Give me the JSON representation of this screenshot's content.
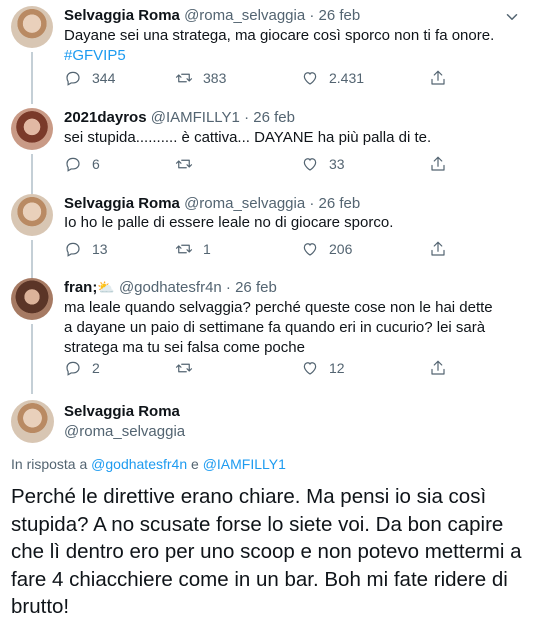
{
  "tweets": [
    {
      "name": "Selvaggia Roma",
      "handle": "@roma_selvaggia",
      "dot": "·",
      "date": "26 feb",
      "text": "Dayane sei una stratega, ma giocare così sporco non ti fa onore.",
      "hashtag": "#GFVIP5",
      "replies": "344",
      "retweets": "383",
      "likes": "2.431"
    },
    {
      "name": "2021dayros",
      "handle": "@IAMFILLY1",
      "dot": "·",
      "date": "26 feb",
      "text": "sei stupida.......... è cattiva... DAYANE ha più palla di te.",
      "replies": "6",
      "retweets": "",
      "likes": "33"
    },
    {
      "name": "Selvaggia Roma",
      "handle": "@roma_selvaggia",
      "dot": "·",
      "date": "26 feb",
      "text": "Io ho le palle di essere leale no di giocare sporco.",
      "replies": "13",
      "retweets": "1",
      "likes": "206"
    },
    {
      "name": "fran;",
      "name_emoji": "⛅",
      "handle": "@godhatesfr4n",
      "dot": "·",
      "date": "26 feb",
      "text": "ma leale quando selvaggia? perché queste cose non le hai dette a dayane un paio di settimane fa quando eri in cucurio? lei sarà stratega ma tu sei falsa come poche",
      "replies": "2",
      "retweets": "",
      "likes": "12"
    }
  ],
  "main_tweet": {
    "name": "Selvaggia Roma",
    "handle": "@roma_selvaggia",
    "reply_prefix": "In risposta a",
    "reply_user1": "@godhatesfr4n",
    "reply_and": "e",
    "reply_user2": "@IAMFILLY1",
    "text": "Perché le direttive erano chiare. Ma pensi io sia così stupida? A no scusate forse lo siete voi. Da bon capire che lì dentro ero per uno scoop e non potevo mettermi a fare 4 chiacchiere come in un bar. Boh mi fate ridere di brutto!"
  },
  "colors": {
    "accent": "#1d9bf0",
    "muted": "#536471",
    "text": "#0f1419"
  }
}
